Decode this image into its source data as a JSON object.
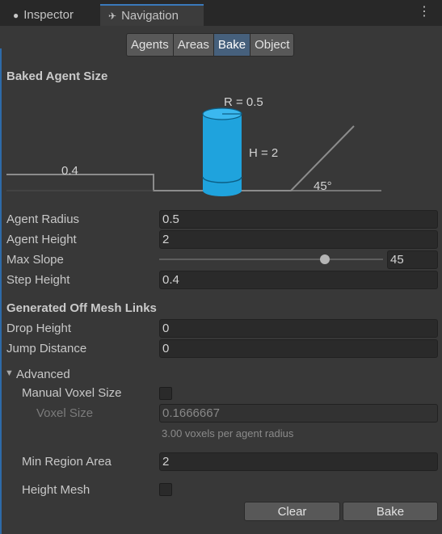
{
  "tabs": [
    {
      "label": "Inspector",
      "icon": "info-icon"
    },
    {
      "label": "Navigation",
      "icon": "navigation-icon",
      "active": true
    }
  ],
  "toolbar": {
    "buttons": [
      "Agents",
      "Areas",
      "Bake",
      "Object"
    ],
    "active": "Bake"
  },
  "baked_agent_size": {
    "title": "Baked Agent Size",
    "diagram": {
      "radius_label": "R = 0.5",
      "height_label": "H = 2",
      "step_label": "0.4",
      "slope_label": "45°"
    }
  },
  "fields": {
    "agent_radius": {
      "label": "Agent Radius",
      "value": "0.5"
    },
    "agent_height": {
      "label": "Agent Height",
      "value": "2"
    },
    "max_slope": {
      "label": "Max Slope",
      "value": "45",
      "slider_min": 0,
      "slider_max": 60
    },
    "step_height": {
      "label": "Step Height",
      "value": "0.4"
    }
  },
  "off_mesh": {
    "title": "Generated Off Mesh Links",
    "drop_height": {
      "label": "Drop Height",
      "value": "0"
    },
    "jump_distance": {
      "label": "Jump Distance",
      "value": "0"
    }
  },
  "advanced": {
    "title": "Advanced",
    "manual_voxel_size": {
      "label": "Manual Voxel Size",
      "checked": false
    },
    "voxel_size": {
      "label": "Voxel Size",
      "value": "0.1666667",
      "hint": "3.00 voxels per agent radius"
    },
    "min_region_area": {
      "label": "Min Region Area",
      "value": "2"
    },
    "height_mesh": {
      "label": "Height Mesh",
      "checked": false
    }
  },
  "actions": {
    "clear": "Clear",
    "bake": "Bake"
  },
  "colors": {
    "accent": "#3a79bb",
    "cylinder": "#1fa3dd",
    "active_tab": "#46607c"
  }
}
